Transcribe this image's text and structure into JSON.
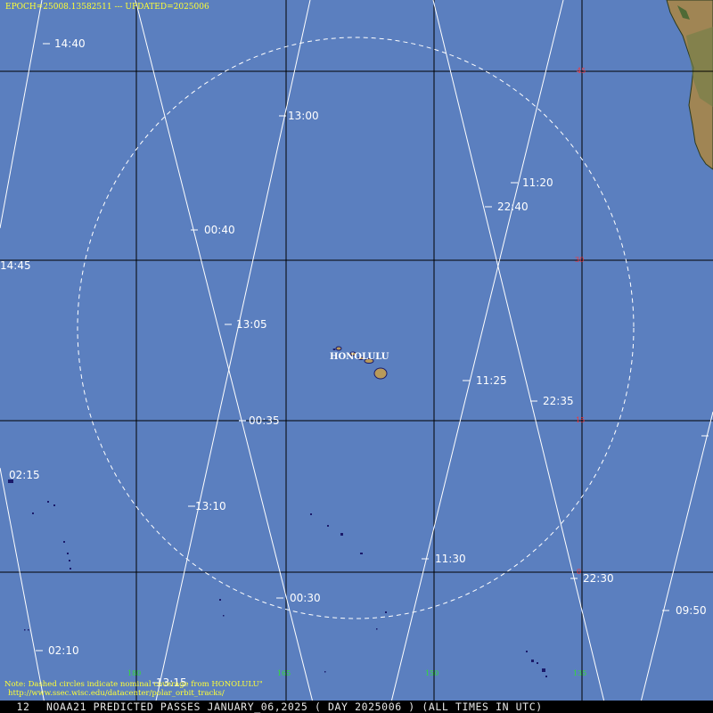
{
  "header": {
    "epoch_text": "EPOCH=25008.13582511 --- UPDATED=2025006"
  },
  "footer": {
    "page_number": "12",
    "title": "NOAA21 PREDICTED PASSES JANUARY_06,2025 ( DAY 2025006 ) (ALL TIMES IN UTC)"
  },
  "note": {
    "line1": "Note: Dashed circles indicate nominal coverage from HONOLULU\"",
    "line2": "http://www.ssec.wisc.edu/datacenter/polar_orbit_tracks/"
  },
  "station": {
    "name": "HONOLULU"
  },
  "colors": {
    "ocean": "#5b7fbf",
    "grid": "#000000",
    "track": "#ffffff",
    "lat_label": "#ff3333",
    "lon_label": "#33dd33",
    "header_text": "#ffff33",
    "land": "#b89a5a"
  },
  "latitude_labels": [
    "45",
    "30",
    "15",
    "0"
  ],
  "longitude_labels": [
    "180",
    "165",
    "150",
    "135"
  ],
  "pass_times": [
    "14:40",
    "14:45",
    "13:00",
    "13:05",
    "13:10",
    "13:15",
    "00:40",
    "00:35",
    "00:30",
    "02:15",
    "02:10",
    "11:20",
    "11:25",
    "11:30",
    "22:40",
    "22:35",
    "22:30",
    "09:50"
  ]
}
